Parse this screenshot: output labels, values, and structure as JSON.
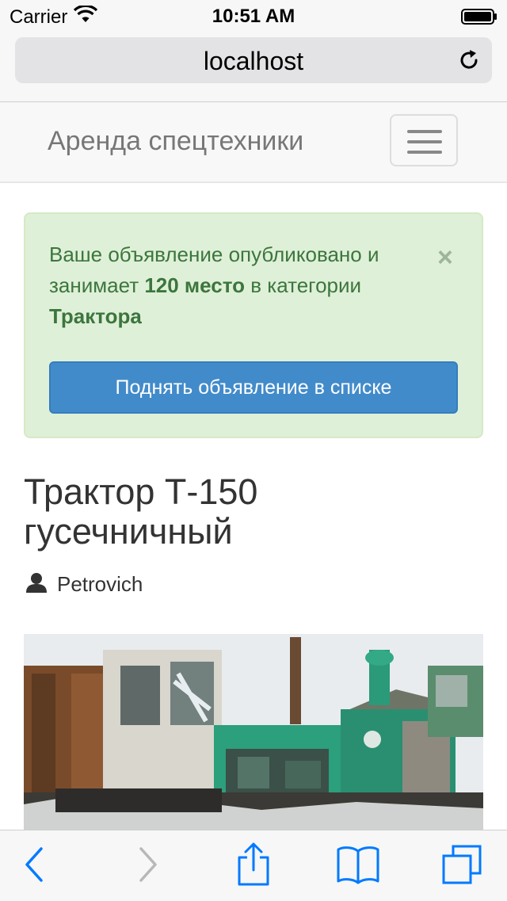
{
  "status_bar": {
    "carrier": "Carrier",
    "time": "10:51 AM"
  },
  "browser": {
    "url": "localhost"
  },
  "navbar": {
    "brand": "Аренда спецтехники"
  },
  "alert": {
    "text_part1": "Ваше объявление опубликовано и занимает ",
    "rank": "120 место",
    "text_part2": " в категории ",
    "category": "Трактора",
    "close_symbol": "×",
    "button_label": "Поднять объявление в списке"
  },
  "ad": {
    "title": "Трактор Т-150 гусечничный",
    "author": "Petrovich"
  },
  "colors": {
    "alert_bg": "#dff0d8",
    "alert_text": "#3c763d",
    "primary_button": "#428bca",
    "ios_tint": "#007aff"
  },
  "icons": {
    "wifi": "wifi-icon",
    "battery": "battery-icon",
    "reload": "reload-icon",
    "user": "user-icon",
    "back": "back-icon",
    "forward": "forward-icon",
    "share": "share-icon",
    "bookmarks": "bookmarks-icon",
    "tabs": "tabs-icon"
  }
}
